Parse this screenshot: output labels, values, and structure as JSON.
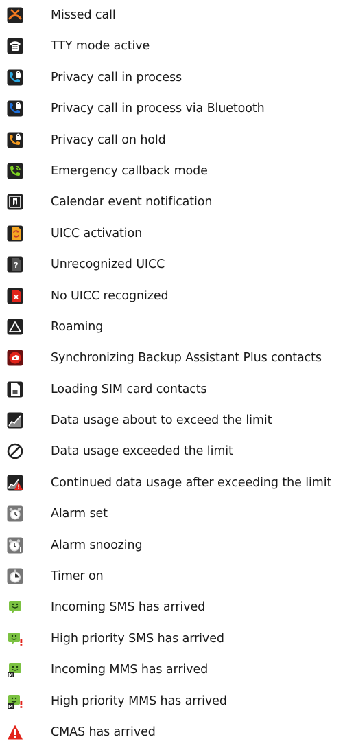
{
  "items": [
    {
      "icon": "missed-call-icon",
      "label": "Missed call"
    },
    {
      "icon": "tty-mode-icon",
      "label": "TTY mode active"
    },
    {
      "icon": "privacy-call-icon",
      "label": "Privacy call in process"
    },
    {
      "icon": "privacy-call-bluetooth-icon",
      "label": "Privacy call in process via Bluetooth"
    },
    {
      "icon": "privacy-call-hold-icon",
      "label": "Privacy call on hold"
    },
    {
      "icon": "emergency-callback-icon",
      "label": "Emergency callback mode"
    },
    {
      "icon": "calendar-event-icon",
      "label": "Calendar event notification"
    },
    {
      "icon": "uicc-activation-icon",
      "label": "UICC activation"
    },
    {
      "icon": "unrecognized-uicc-icon",
      "label": "Unrecognized UICC"
    },
    {
      "icon": "no-uicc-icon",
      "label": "No UICC recognized"
    },
    {
      "icon": "roaming-icon",
      "label": "Roaming"
    },
    {
      "icon": "backup-assistant-sync-icon",
      "label": "Synchronizing Backup Assistant Plus contacts"
    },
    {
      "icon": "sim-contacts-icon",
      "label": "Loading SIM card contacts"
    },
    {
      "icon": "data-usage-warning-icon",
      "label": "Data usage about to exceed the limit"
    },
    {
      "icon": "data-limit-exceeded-icon",
      "label": "Data usage exceeded the limit"
    },
    {
      "icon": "data-usage-continued-icon",
      "label": "Continued data usage after exceeding the limit"
    },
    {
      "icon": "alarm-set-icon",
      "label": "Alarm set"
    },
    {
      "icon": "alarm-snooze-icon",
      "label": "Alarm snoozing"
    },
    {
      "icon": "timer-icon",
      "label": "Timer on"
    },
    {
      "icon": "sms-icon",
      "label": "Incoming SMS has arrived"
    },
    {
      "icon": "sms-priority-icon",
      "label": "High priority SMS has arrived"
    },
    {
      "icon": "mms-icon",
      "label": "Incoming MMS has arrived"
    },
    {
      "icon": "mms-priority-icon",
      "label": "High priority MMS has arrived"
    },
    {
      "icon": "cmas-alert-icon",
      "label": "CMAS has arrived"
    }
  ],
  "colors": {
    "text": "#1a1a1a",
    "icon_dark": "#222222",
    "missed_orange": "#f47a20",
    "phone_blue": "#2aa7e0",
    "phone_orange": "#f39a1e",
    "emergency_green": "#7ed321",
    "sms_green": "#7cc242",
    "alert_red": "#e2231a"
  }
}
